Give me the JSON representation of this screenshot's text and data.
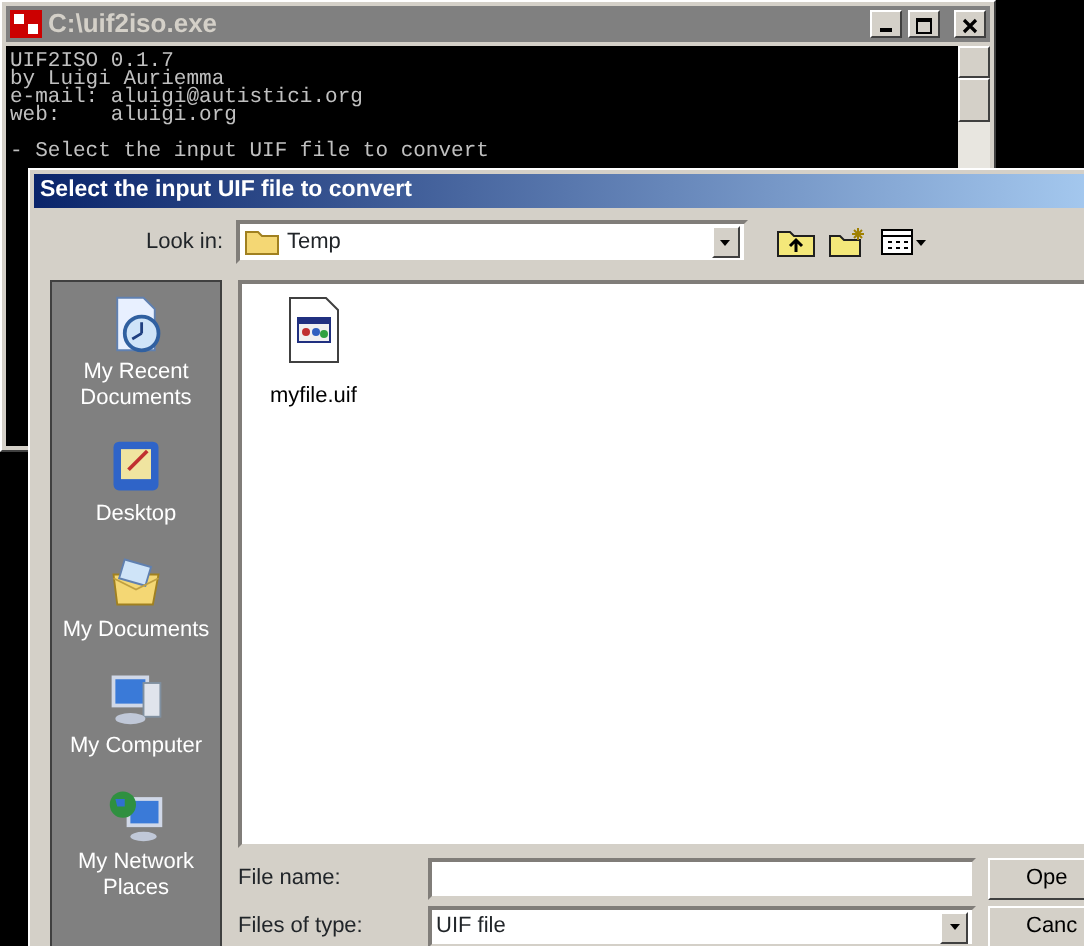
{
  "console": {
    "title": "C:\\uif2iso.exe",
    "lines": [
      "UIF2ISO 0.1.7",
      "by Luigi Auriemma",
      "e-mail: aluigi@autistici.org",
      "web:    aluigi.org"
    ],
    "prompt": "- Select the input UIF file to convert"
  },
  "dialog": {
    "title": "Select the input UIF file to convert",
    "look_in": {
      "label": "Look in:",
      "value": "Temp"
    },
    "places": [
      {
        "kind": "recent",
        "label": "My Recent Documents"
      },
      {
        "kind": "desktop",
        "label": "Desktop"
      },
      {
        "kind": "documents",
        "label": "My Documents"
      },
      {
        "kind": "computer",
        "label": "My Computer"
      },
      {
        "kind": "network",
        "label": "My Network Places"
      }
    ],
    "files": [
      {
        "name": "myfile.uif"
      }
    ],
    "file_name": {
      "label": "File name:"
    },
    "file_type": {
      "label": "Files of type:",
      "value": "UIF file"
    },
    "buttons": [
      "Ope",
      "Canc"
    ]
  }
}
